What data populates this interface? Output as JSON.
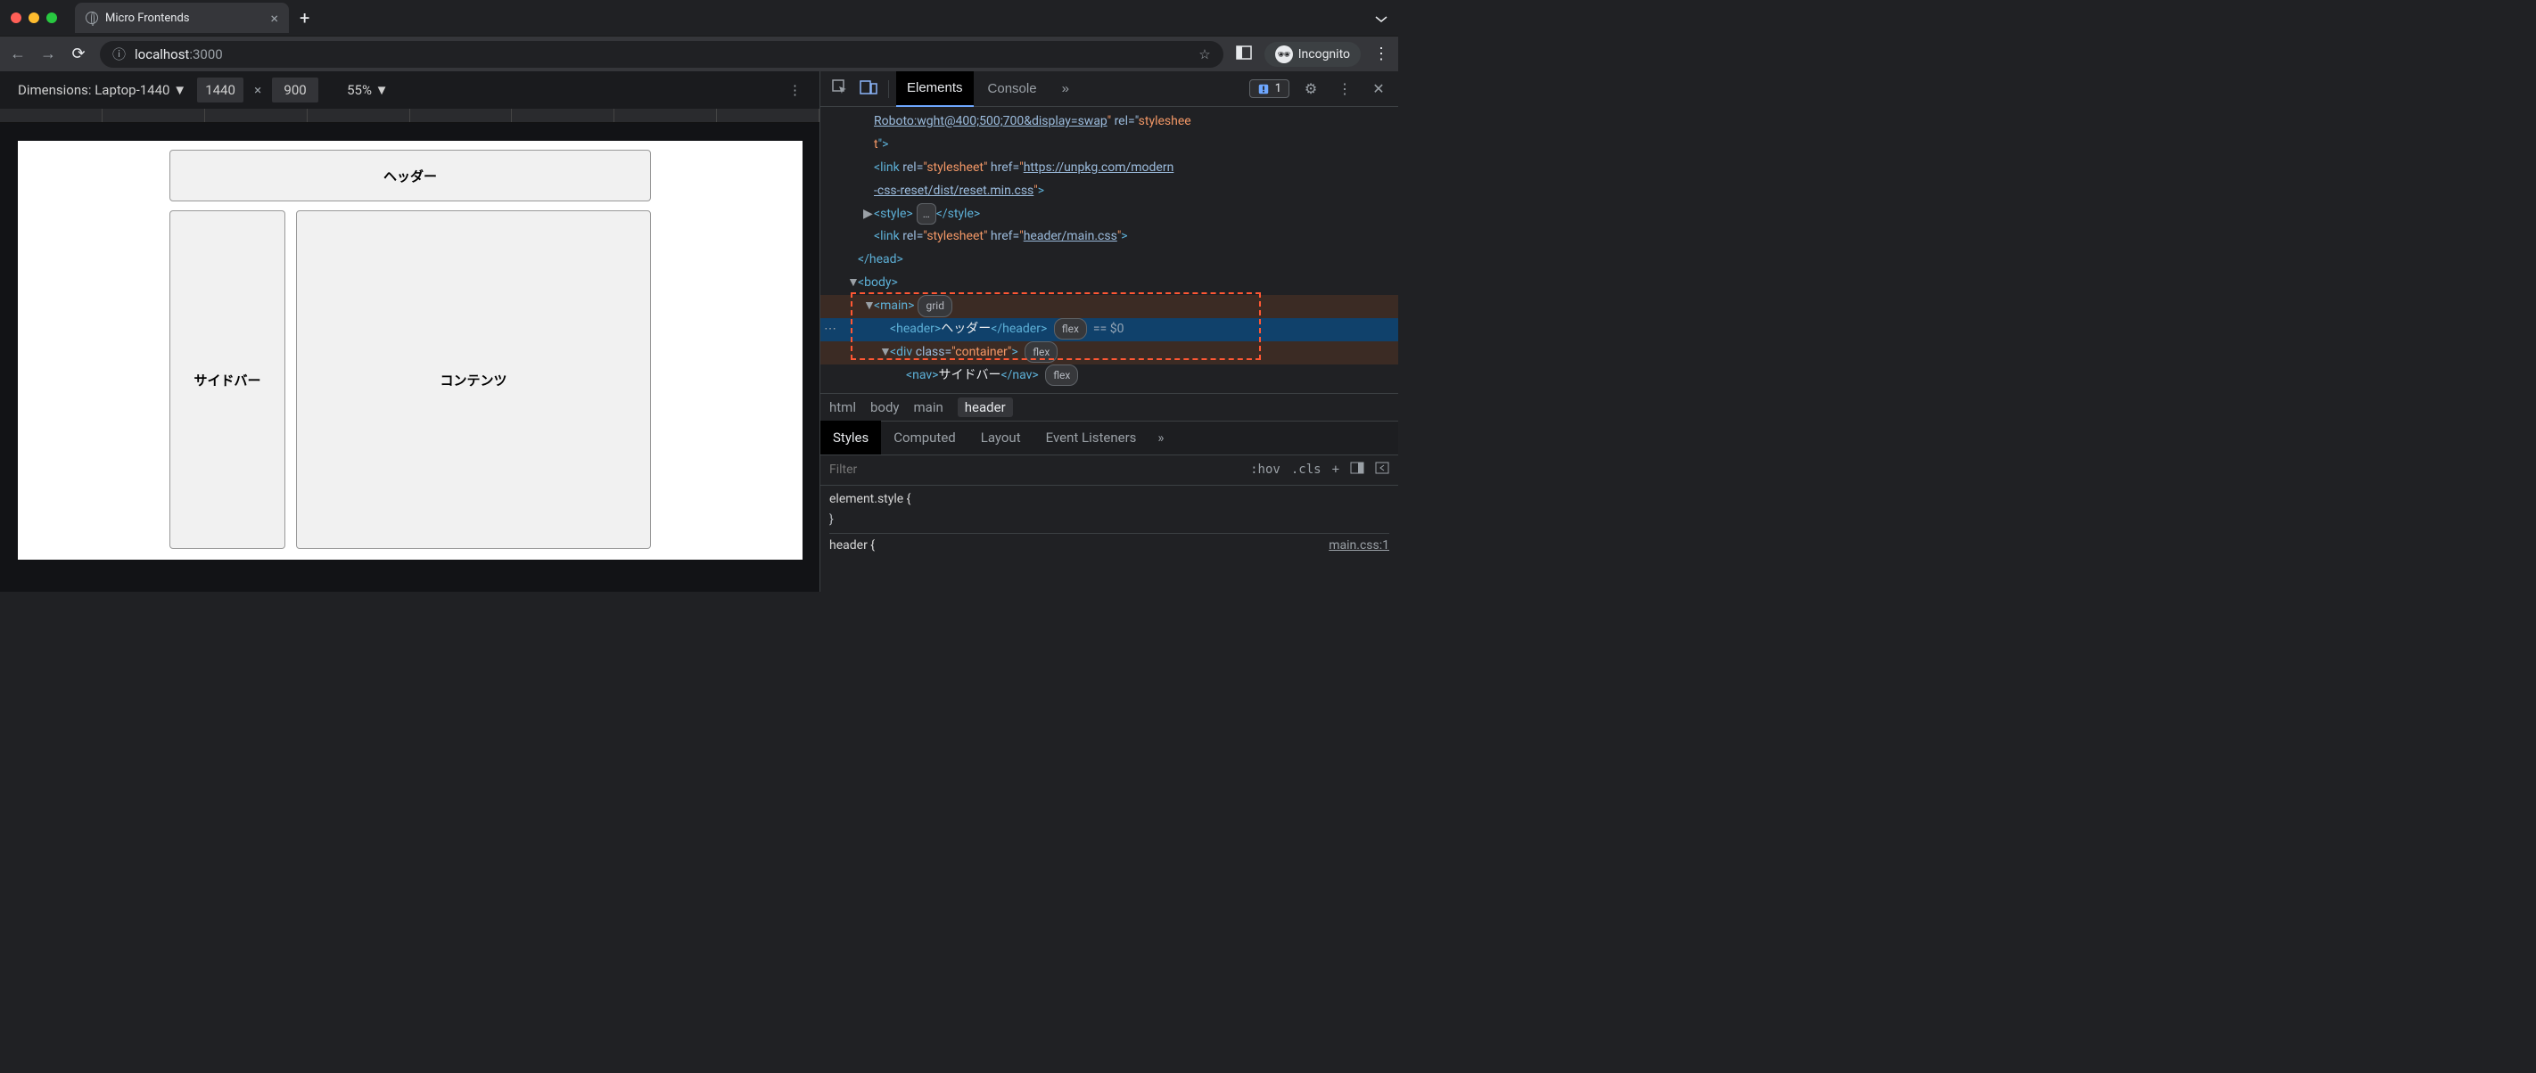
{
  "window": {
    "tab_title": "Micro Frontends",
    "incognito_label": "Incognito"
  },
  "url": {
    "info_prefix": "ⓘ",
    "host": "localhost",
    "rest": ":3000"
  },
  "device_toolbar": {
    "dimensions_label": "Dimensions: Laptop-1440",
    "width": "1440",
    "height": "900",
    "times": "×",
    "zoom": "55%"
  },
  "page": {
    "header": "ヘッダー",
    "sidebar": "サイドバー",
    "content": "コンテンツ"
  },
  "devtools": {
    "tabs": {
      "elements": "Elements",
      "console": "Console"
    },
    "issues_count": "1",
    "dom": {
      "l0": "Roboto:wght@400;500;700&display=swap",
      "l0b": "\"",
      "l0c": " rel=\"",
      "l0d": "styleshee",
      "l1": "t",
      "l1b": "\">",
      "l2_link_href": "https://unpkg.com/modern",
      "l3": "-css-reset/dist/reset.min.css",
      "l4_open": "<style>",
      "l4_close": "</style>",
      "l5_href": "header/main.css",
      "head_close": "</head>",
      "body_open": "<body>",
      "main_open": "<main>",
      "main_badge": "grid",
      "header_open": "<header>",
      "header_text": "ヘッダー",
      "header_close": "</header>",
      "flex_badge": "flex",
      "seleq": "== $0",
      "div_container": "<div class=\"container\">",
      "nav_open": "<nav>",
      "nav_text": "サイドバー",
      "nav_close": "</nav>"
    },
    "crumbs": {
      "c1": "html",
      "c2": "body",
      "c3": "main",
      "c4": "header"
    },
    "styles_tabs": {
      "styles": "Styles",
      "computed": "Computed",
      "layout": "Layout",
      "event": "Event Listeners"
    },
    "filter": {
      "placeholder": "Filter",
      "hov": ":hov",
      "cls": ".cls"
    },
    "rules": {
      "r1": "element.style {",
      "r1c": "}",
      "r2": "header {",
      "r2src": "main.css:1"
    }
  }
}
